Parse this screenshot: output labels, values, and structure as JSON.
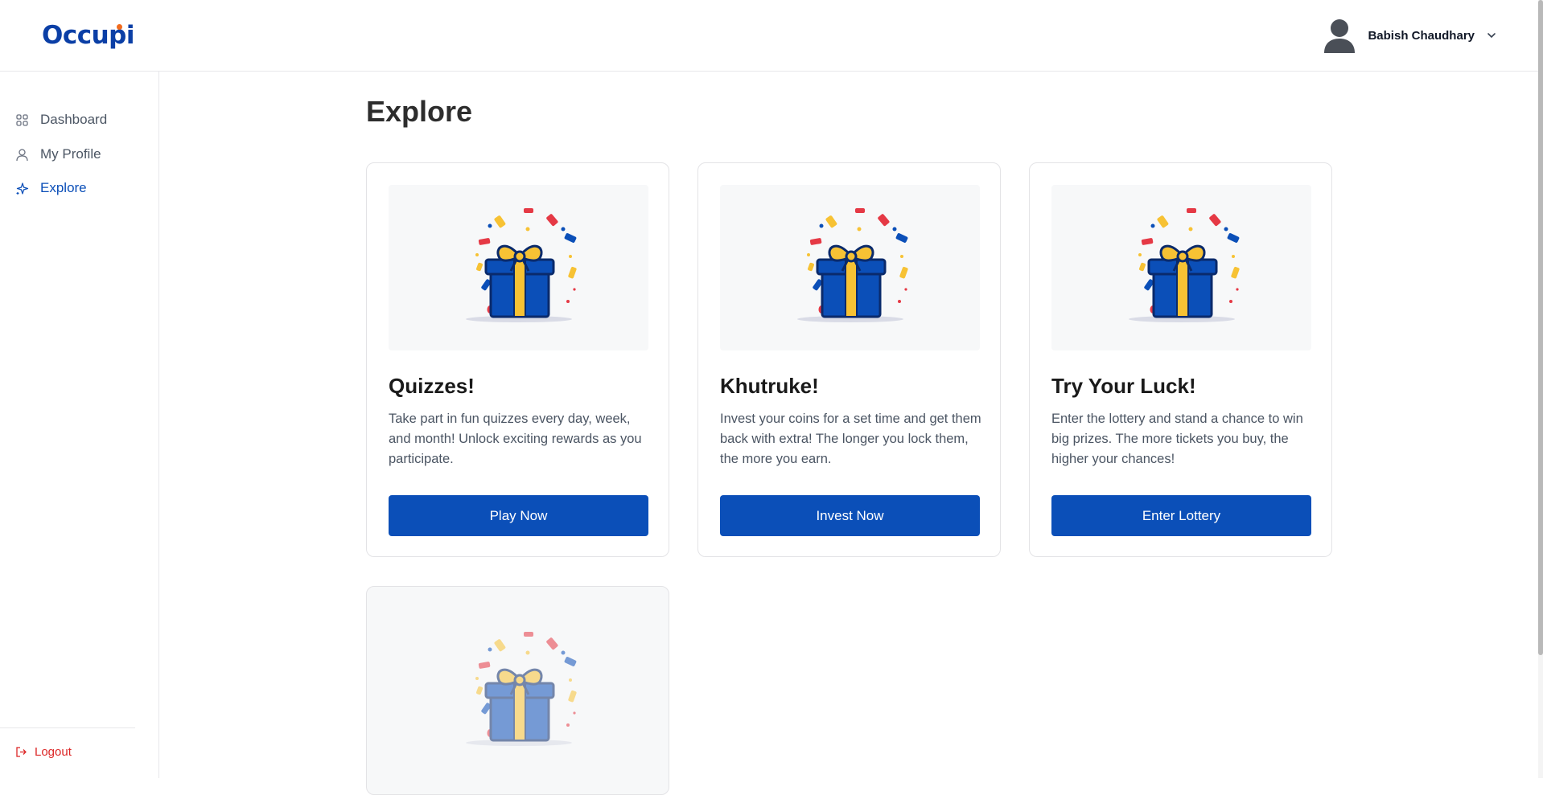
{
  "app": {
    "logo": "Occupi"
  },
  "header": {
    "user_name": "Babish Chaudhary"
  },
  "sidebar": {
    "items": [
      {
        "label": "Dashboard",
        "icon": "grid-icon",
        "active": false
      },
      {
        "label": "My Profile",
        "icon": "user-icon",
        "active": false
      },
      {
        "label": "Explore",
        "icon": "sparkle-icon",
        "active": true
      }
    ],
    "logout_label": "Logout"
  },
  "main": {
    "title": "Explore",
    "cards": [
      {
        "title": "Quizzes!",
        "description": "Take part in fun quizzes every day, week, and month! Unlock exciting rewards as you participate.",
        "button": "Play Now",
        "image": "gift-confetti-icon"
      },
      {
        "title": "Khutruke!",
        "description": "Invest your coins for a set time and get them back with extra! The longer you lock them, the more you earn.",
        "button": "Invest Now",
        "image": "gift-confetti-icon"
      },
      {
        "title": "Try Your Luck!",
        "description": "Enter the lottery and stand a chance to win big prizes. The more tickets you buy, the higher your chances!",
        "button": "Enter Lottery",
        "image": "gift-confetti-icon"
      },
      {
        "image": "gift-confetti-icon"
      }
    ]
  },
  "colors": {
    "primary": "#0b4fb8",
    "logo": "#0b3fa6",
    "logo_accent": "#f26b1d",
    "logout": "#dc2626",
    "gift_box": "#0b4fb8",
    "ribbon": "#f7c234"
  }
}
